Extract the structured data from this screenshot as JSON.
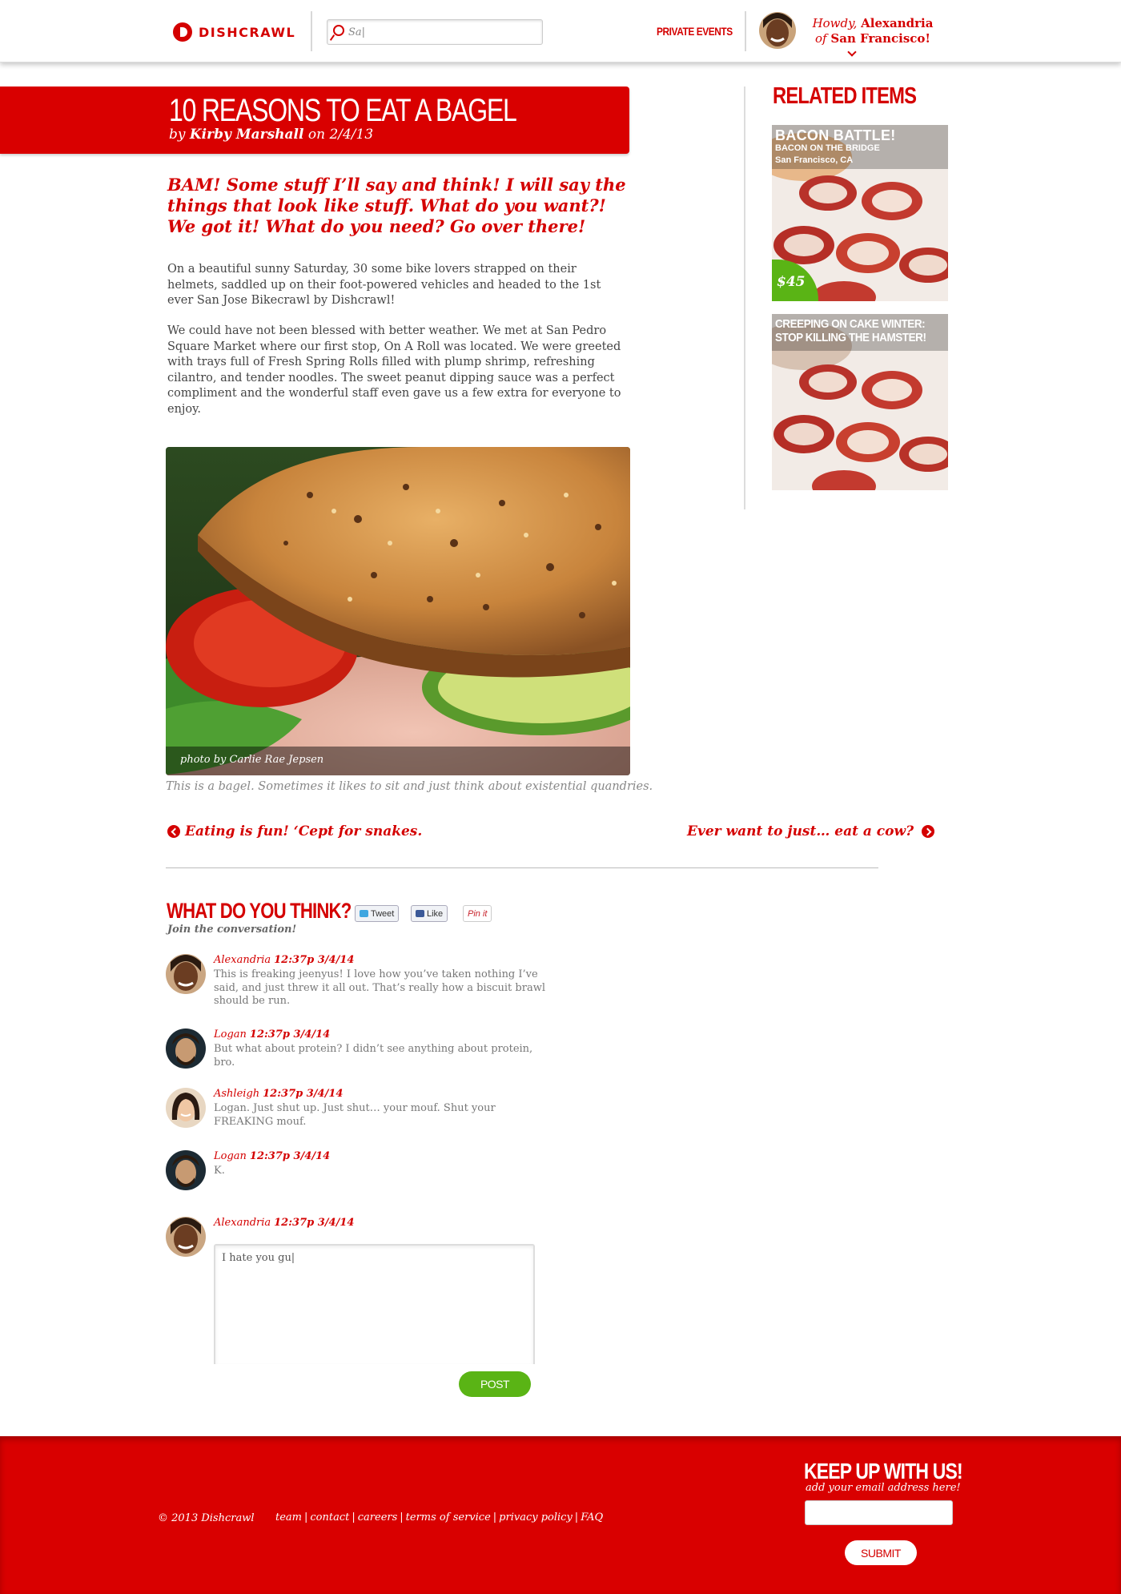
{
  "colors": {
    "brand_red": "#d40000",
    "green": "#5ab415"
  },
  "header": {
    "logo_text": "DISHCRAWL",
    "search": {
      "value": "Sa|",
      "placeholder": ""
    },
    "private_events": "PRIVATE EVENTS",
    "howdy_prefix": "Howdy,",
    "user_name": "Alexandria",
    "of": "of",
    "city": "San Francisco!"
  },
  "article": {
    "title": "10 REASONS TO EAT A BAGEL",
    "by": "by",
    "author": "Kirby Marshall",
    "on": "on",
    "date": "2/4/13",
    "lede": "BAM! Some stuff I’ll say and think! I will say the things that look like stuff. What do you want?! We got it! What do you need? Go over there!",
    "paragraphs": [
      "On a beautiful sunny Saturday, 30 some bike lovers strapped on their helmets, saddled up on their foot-powered vehicles and headed to the 1st ever San Jose Bikecrawl by Dishcrawl!",
      "We could have not been blessed with better weather. We met at San Pedro Square Market where our first stop, On A Roll was located. We were greeted with trays full of Fresh Spring Rolls filled with plump shrimp, refreshing cilantro, and tender noodles. The sweet peanut dipping sauce was a perfect compliment and the wonderful staff even gave us a few extra for everyone to enjoy."
    ],
    "photo_credit": "photo by Carlie Rae Jepsen",
    "caption": "This is a bagel. Sometimes it likes to sit and just think about existential quandries.",
    "prev_link": "Eating is fun! ‘Cept for snakes.",
    "next_link": "Ever want to just… eat a cow?"
  },
  "comments": {
    "heading": "WHAT DO YOU THINK?",
    "subheading": "Join the conversation!",
    "share": {
      "tweet": "Tweet",
      "like": "Like",
      "pin": "Pin it"
    },
    "items": [
      {
        "name": "Alexandria",
        "time": "12:37p 3/4/14",
        "text": "This is freaking jeenyus! I love how you’ve taken nothing I’ve said, and just threw it all out. That’s really how a biscuit brawl should be run."
      },
      {
        "name": "Logan",
        "time": "12:37p 3/4/14",
        "text": "But what about protein? I didn’t see anything about protein, bro."
      },
      {
        "name": "Ashleigh",
        "time": "12:37p 3/4/14",
        "text": "Logan. Just shut up. Just shut… your mouf. Shut your FREAKING mouf."
      },
      {
        "name": "Logan",
        "time": "12:37p 3/4/14",
        "text": "K."
      }
    ],
    "reply": {
      "name": "Alexandria",
      "time": "12:37p 3/4/14",
      "value": "I hate you gu|"
    },
    "post_button": "POST"
  },
  "sidebar": {
    "heading": "RELATED ITEMS",
    "cards": [
      {
        "title": "BACON BATTLE!",
        "subtitle": "BACON ON THE BRIDGE",
        "location": "San Francisco, CA",
        "price": "$45"
      },
      {
        "title_line1": "CREEPING ON CAKE WINTER:",
        "title_line2": "STOP KILLING THE HAMSTER!"
      }
    ]
  },
  "footer": {
    "copyright": "© 2013 Dishcrawl",
    "links": [
      "team",
      "contact",
      "careers",
      "terms of service",
      "privacy policy",
      "FAQ"
    ],
    "keep_up": "KEEP UP WITH US!",
    "keep_up_sub": "add your email address here!",
    "email": {
      "value": "",
      "placeholder": ""
    },
    "submit": "SUBMIT"
  }
}
